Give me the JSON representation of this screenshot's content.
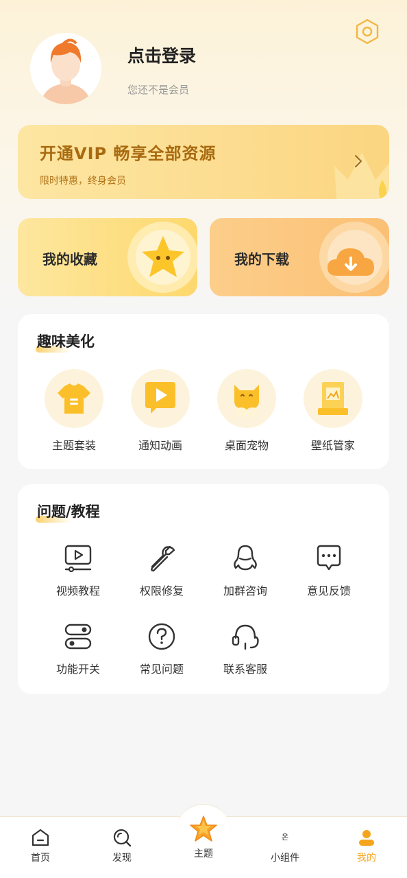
{
  "profile": {
    "login_title": "点击登录",
    "member_status": "您还不是会员"
  },
  "vip_banner": {
    "title": "开通VIP 畅享全部资源",
    "subtitle": "限时特惠，终身会员"
  },
  "shortcut_cards": [
    {
      "label": "我的收藏",
      "icon": "star-icon"
    },
    {
      "label": "我的下载",
      "icon": "cloud-download-icon"
    }
  ],
  "fun_section": {
    "title": "趣味美化",
    "items": [
      {
        "label": "主题套装",
        "icon": "tshirt-icon"
      },
      {
        "label": "通知动画",
        "icon": "play-message-icon"
      },
      {
        "label": "桌面宠物",
        "icon": "cat-pet-icon"
      },
      {
        "label": "壁纸管家",
        "icon": "wallpaper-icon"
      }
    ]
  },
  "help_section": {
    "title": "问题/教程",
    "items": [
      {
        "label": "视频教程",
        "icon": "video-tutorial-icon"
      },
      {
        "label": "权限修复",
        "icon": "wrench-icon"
      },
      {
        "label": "加群咨询",
        "icon": "qq-penguin-icon"
      },
      {
        "label": "意见反馈",
        "icon": "chat-bubble-icon"
      },
      {
        "label": "功能开关",
        "icon": "toggle-switches-icon"
      },
      {
        "label": "常见问题",
        "icon": "question-circle-icon"
      },
      {
        "label": "联系客服",
        "icon": "headset-icon"
      }
    ]
  },
  "tabbar": {
    "tabs": [
      {
        "label": "首页",
        "icon": "home-icon"
      },
      {
        "label": "发现",
        "icon": "discover-icon"
      },
      {
        "label": "主题",
        "icon": "star-theme-icon"
      },
      {
        "label": "小组件",
        "icon": "widget-icon"
      },
      {
        "label": "我的",
        "icon": "profile-icon",
        "active": true
      }
    ],
    "widget_icon_glyph": "온"
  },
  "colors": {
    "accent": "#f4a51c",
    "vip_text": "#a86a10",
    "panel_bg": "#ffffff",
    "page_bg": "#f6f6f6"
  }
}
